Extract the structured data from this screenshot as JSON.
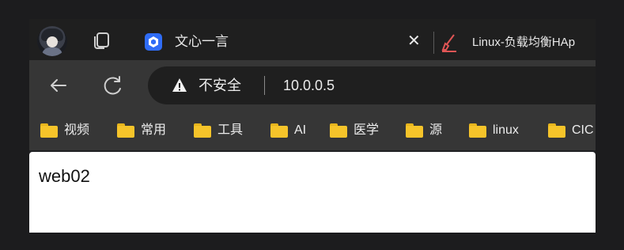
{
  "tabs": {
    "active": {
      "title": "文心一言",
      "close_glyph": "✕"
    },
    "second": {
      "title": "Linux-负载均衡HAp"
    }
  },
  "toolbar": {
    "back_glyph": "←",
    "security_label": "不安全",
    "url": "10.0.0.5"
  },
  "bookmarks": [
    {
      "label": "视频"
    },
    {
      "label": "常用"
    },
    {
      "label": "工具"
    },
    {
      "label": "AI"
    },
    {
      "label": "医学"
    },
    {
      "label": "源"
    },
    {
      "label": "linux"
    },
    {
      "label": "CIC"
    }
  ],
  "page": {
    "text": "web02"
  },
  "colors": {
    "tab_strip": "#1f1f1f",
    "toolbar": "#363636",
    "omnibox": "#1f1f1f",
    "folder": "#f6c42a",
    "favicon_active": "#2f6cf6",
    "page_bg": "#ffffff"
  }
}
